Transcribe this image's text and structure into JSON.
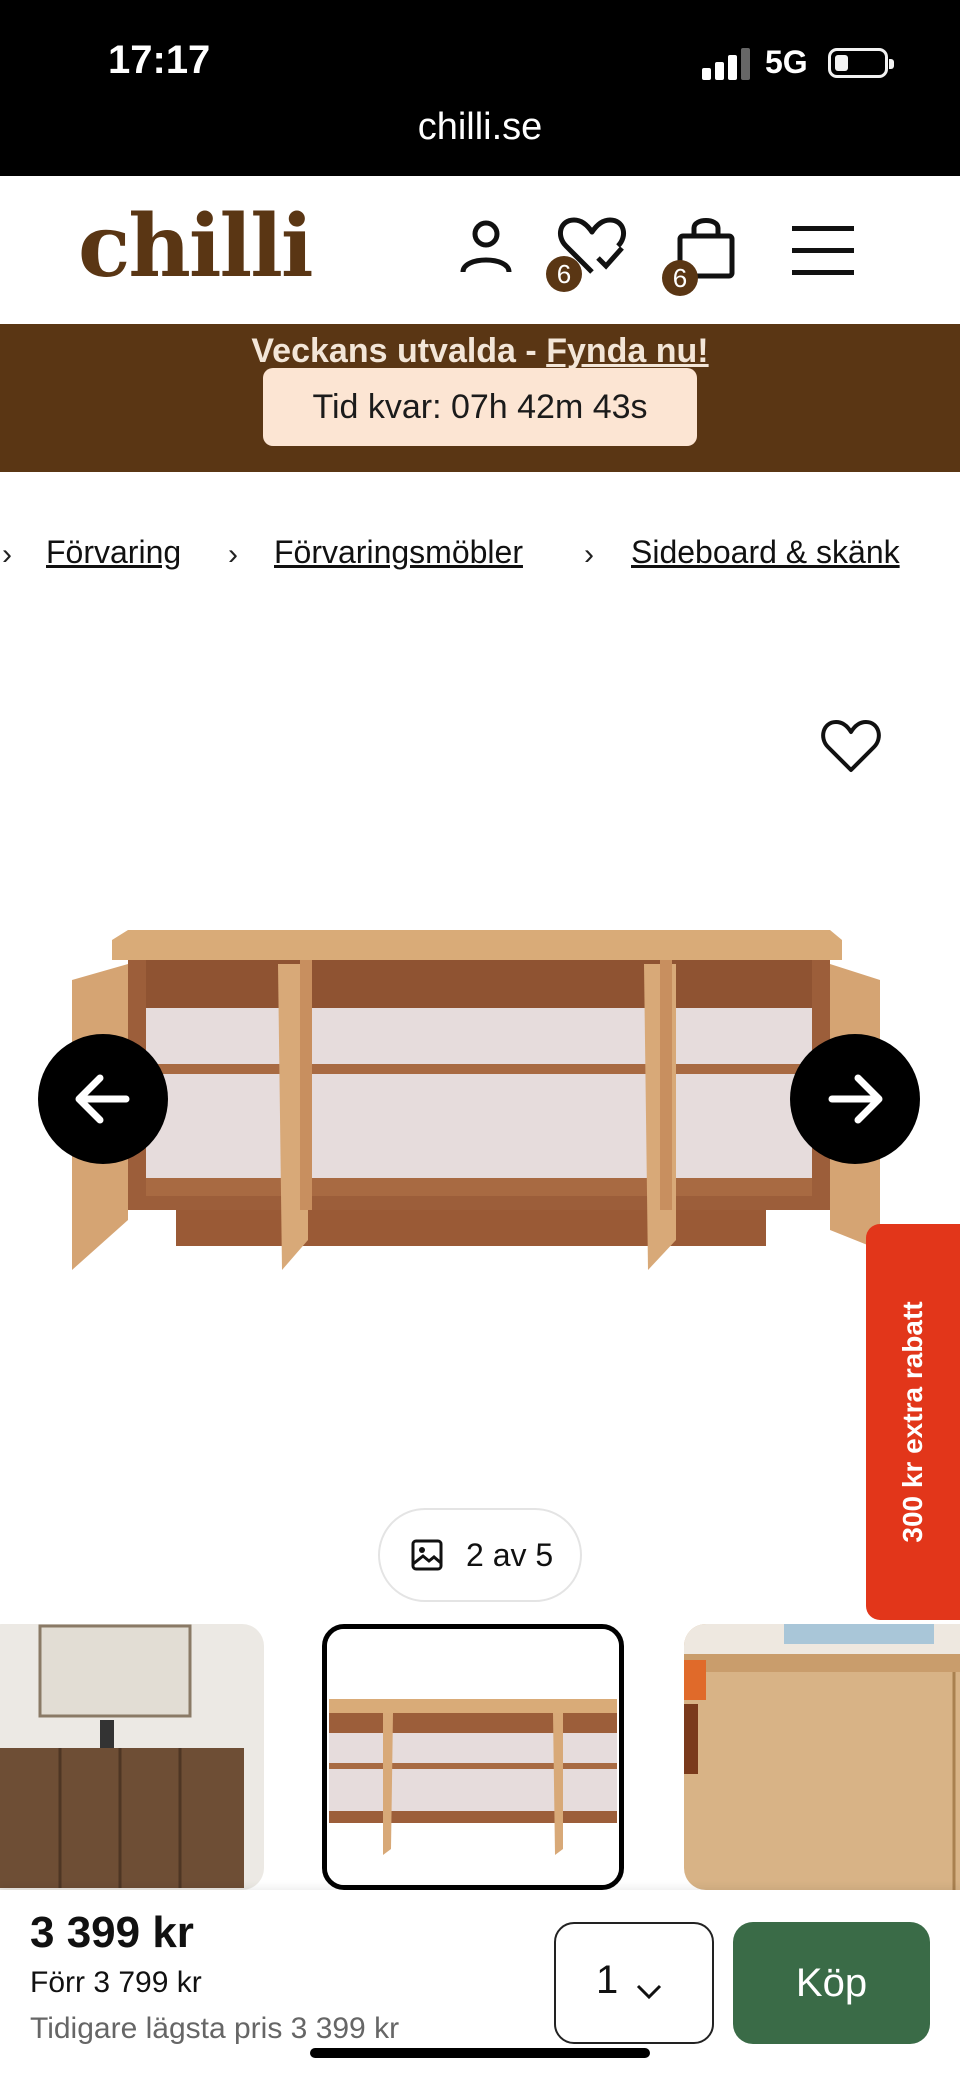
{
  "status_bar": {
    "time": "17:17",
    "network": "5G",
    "url": "chilli.se"
  },
  "header": {
    "logo": "chilli",
    "account_icon": "user-icon",
    "wishlist_icon": "heart-check-icon",
    "wishlist_count": "6",
    "cart_icon": "shopping-bag-icon",
    "cart_count": "6",
    "menu_icon": "hamburger-menu-icon"
  },
  "promo": {
    "text": "Veckans utvalda - ",
    "link": "Fynda nu!",
    "countdown": "Tid kvar: 07h 42m 43s",
    "background": "#5a3614"
  },
  "breadcrumb": {
    "items": [
      "Förvaring",
      "Förvaringsmöbler",
      "Sideboard & skänk"
    ]
  },
  "gallery": {
    "counter": "2 av 5",
    "current_index": 2,
    "total": 5
  },
  "side_tab": {
    "label": "300 kr extra rabatt",
    "color": "#e2361a"
  },
  "purchase": {
    "price": "3 399 kr",
    "previous_price": "Förr 3 799 kr",
    "lowest_price": "Tidigare lägsta pris 3 399 kr",
    "quantity": "1",
    "buy_label": "Köp",
    "buy_color": "#3a6b47"
  }
}
